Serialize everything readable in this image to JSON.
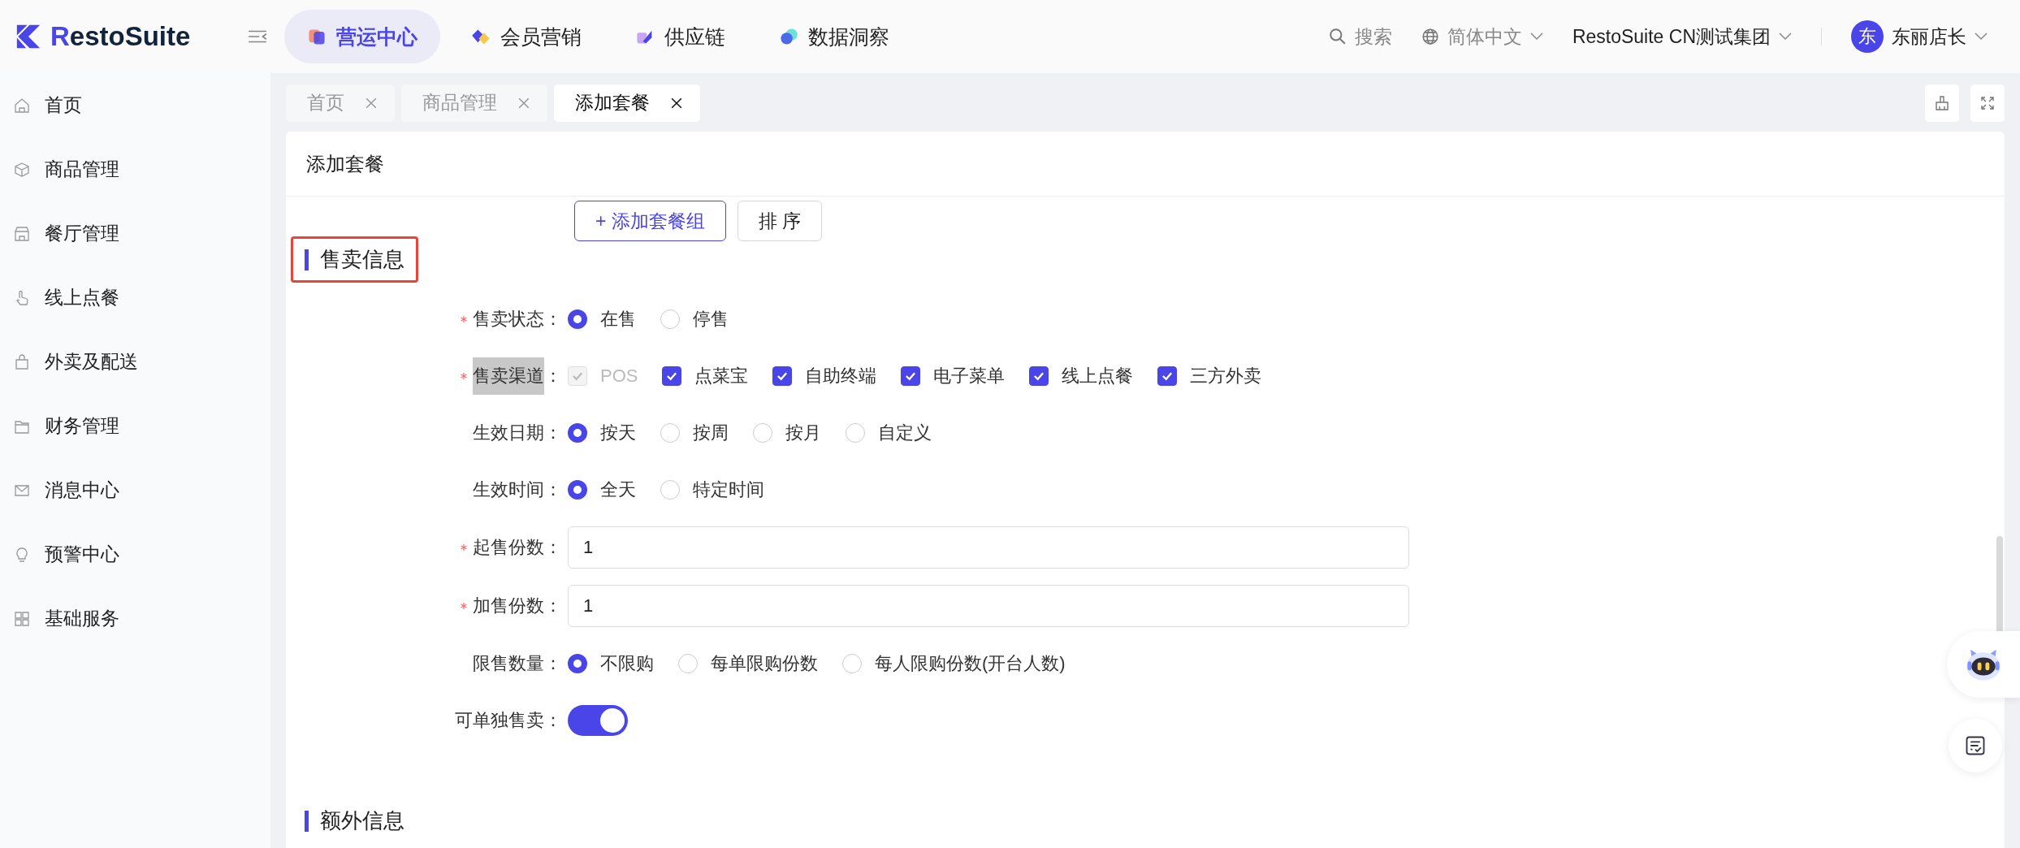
{
  "brand": {
    "name": "RestoSuite"
  },
  "top_nav": [
    {
      "label": "营运中心",
      "selected": true
    },
    {
      "label": "会员营销",
      "selected": false
    },
    {
      "label": "供应链",
      "selected": false
    },
    {
      "label": "数据洞察",
      "selected": false
    }
  ],
  "search": {
    "label": "搜索"
  },
  "language": {
    "label": "简体中文"
  },
  "organization": {
    "label": "RestoSuite CN测试集团"
  },
  "user": {
    "avatar": "东",
    "name": "东丽店长"
  },
  "sidebar": {
    "items": [
      {
        "label": "首页"
      },
      {
        "label": "商品管理"
      },
      {
        "label": "餐厅管理"
      },
      {
        "label": "线上点餐"
      },
      {
        "label": "外卖及配送"
      },
      {
        "label": "财务管理"
      },
      {
        "label": "消息中心"
      },
      {
        "label": "预警中心"
      },
      {
        "label": "基础服务"
      }
    ]
  },
  "tabs": [
    {
      "label": "首页",
      "selected": false
    },
    {
      "label": "商品管理",
      "selected": false
    },
    {
      "label": "添加套餐",
      "selected": true
    }
  ],
  "page_title": "添加套餐",
  "toolbar_buttons": [
    {
      "label": "+ 添加套餐组",
      "kind": "primary"
    },
    {
      "label": "排 序",
      "kind": "default"
    }
  ],
  "sections": [
    {
      "title": "售卖信息",
      "outlined": true,
      "fields": [
        {
          "kind": "radio",
          "label": "售卖状态",
          "suffix": "：",
          "required": true,
          "label_highlighted": false,
          "options": [
            {
              "label": "在售",
              "selected": true
            },
            {
              "label": "停售",
              "selected": false
            }
          ]
        },
        {
          "kind": "checkbox",
          "label": "售卖渠道",
          "suffix": "：",
          "required": true,
          "label_highlighted": true,
          "options": [
            {
              "label": "POS",
              "checked": true,
              "disabled": true
            },
            {
              "label": "点菜宝",
              "checked": true,
              "disabled": false
            },
            {
              "label": "自助终端",
              "checked": true,
              "disabled": false
            },
            {
              "label": "电子菜单",
              "checked": true,
              "disabled": false
            },
            {
              "label": "线上点餐",
              "checked": true,
              "disabled": false
            },
            {
              "label": "三方外卖",
              "checked": true,
              "disabled": false
            }
          ]
        },
        {
          "kind": "radio",
          "label": "生效日期",
          "suffix": "：",
          "required": false,
          "label_highlighted": false,
          "options": [
            {
              "label": "按天",
              "selected": true
            },
            {
              "label": "按周",
              "selected": false
            },
            {
              "label": "按月",
              "selected": false
            },
            {
              "label": "自定义",
              "selected": false
            }
          ]
        },
        {
          "kind": "radio",
          "label": "生效时间",
          "suffix": "：",
          "required": false,
          "label_highlighted": false,
          "options": [
            {
              "label": "全天",
              "selected": true
            },
            {
              "label": "特定时间",
              "selected": false
            }
          ]
        },
        {
          "kind": "input",
          "label": "起售份数",
          "suffix": "：",
          "required": true,
          "label_highlighted": false,
          "value": "1"
        },
        {
          "kind": "input",
          "label": "加售份数",
          "suffix": "：",
          "required": true,
          "label_highlighted": false,
          "value": "1"
        },
        {
          "kind": "radio",
          "label": "限售数量",
          "suffix": "：",
          "required": false,
          "label_highlighted": false,
          "options": [
            {
              "label": "不限购",
              "selected": true
            },
            {
              "label": "每单限购份数",
              "selected": false
            },
            {
              "label": "每人限购份数(开台人数)",
              "selected": false
            }
          ]
        },
        {
          "kind": "switch",
          "label": "可单独售卖",
          "suffix": "：",
          "required": false,
          "label_highlighted": false,
          "on": true
        }
      ]
    },
    {
      "title": "额外信息",
      "outlined": false
    }
  ]
}
